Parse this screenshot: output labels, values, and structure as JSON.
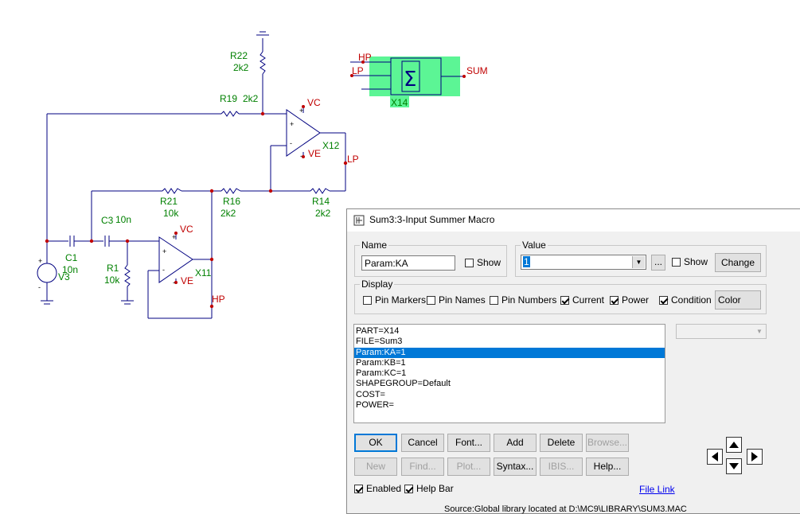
{
  "schematic": {
    "labels": {
      "r22_name": "R22",
      "r22_val": "2k2",
      "r19_name": "R19",
      "r19_val": "2k2",
      "vc_top": "VC",
      "ve_top": "VE",
      "x12": "X12",
      "lp": "LP",
      "r21_name": "R21",
      "r21_val": "10k",
      "r16_name": "R16",
      "r16_val": "2k2",
      "r14_name": "R14",
      "r14_val": "2k2",
      "c3_name": "C3",
      "c3_val": "10n",
      "c1_name": "C1",
      "c1_val": "10n",
      "v3": "V3",
      "r1_name": "R1",
      "r1_val": "10k",
      "vc_bot": "VC",
      "ve_bot": "VE",
      "x11": "X11",
      "hp": "HP",
      "macro_hp": "HP",
      "macro_lp": "LP",
      "macro_sum": "SUM",
      "macro_x14": "X14",
      "sigma": "Σ"
    },
    "colors": {
      "wire": "#000080",
      "label": "#008000",
      "node": "#c00000",
      "macro_fill": "#5cf595"
    }
  },
  "dialog": {
    "title": "Sum3:3-Input Summer Macro",
    "title_icon": "component-icon",
    "name_group": "Name",
    "name_value": "Param:KA",
    "name_show": "Show",
    "value_group": "Value",
    "value_value": "1",
    "value_browse": "...",
    "value_show": "Show",
    "change_btn": "Change",
    "display_group": "Display",
    "display_checks": [
      {
        "label": "Pin Markers",
        "checked": false
      },
      {
        "label": "Pin Names",
        "checked": false
      },
      {
        "label": "Pin Numbers",
        "checked": false
      },
      {
        "label": "Current",
        "checked": true
      },
      {
        "label": "Power",
        "checked": true
      },
      {
        "label": "Condition",
        "checked": true
      }
    ],
    "color_btn": "Color",
    "attributes": [
      "PART=X14",
      "FILE=Sum3",
      "Param:KA=1",
      "Param:KB=1",
      "Param:KC=1",
      "SHAPEGROUP=Default",
      "COST=",
      "POWER="
    ],
    "selected_attribute": 2,
    "buttons_row1": [
      "OK",
      "Cancel",
      "Font...",
      "Add",
      "Delete",
      "Browse..."
    ],
    "buttons_row2": [
      "New",
      "Find...",
      "Plot...",
      "Syntax...",
      "IBIS...",
      "Help..."
    ],
    "enabled_label": "Enabled",
    "helpbar_label": "Help Bar",
    "file_link": "File Link",
    "source_text": "Source:Global library located at D:\\MC9\\LIBRARY\\SUM3.MAC"
  }
}
